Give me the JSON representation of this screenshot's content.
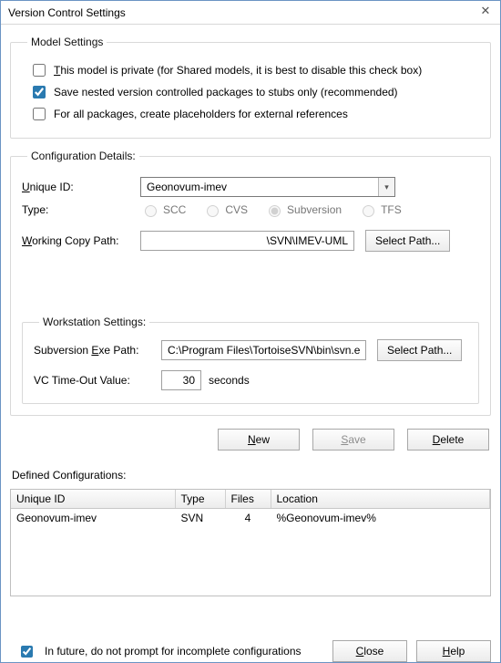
{
  "title": "Version Control Settings",
  "model_settings": {
    "legend": "Model Settings",
    "private_label": "This model is private (for Shared models, it is best to disable this check box)",
    "private_checked": false,
    "stubs_label": "Save nested version controlled packages to stubs only (recommended)",
    "stubs_checked": true,
    "placeholders_label": "For all packages, create placeholders for external references",
    "placeholders_checked": false
  },
  "config": {
    "legend": "Configuration Details:",
    "unique_id_label": "Unique ID:",
    "unique_id_value": "Geonovum-imev",
    "type_label": "Type:",
    "types": {
      "scc": "SCC",
      "cvs": "CVS",
      "svn": "Subversion",
      "tfs": "TFS",
      "selected": "svn"
    },
    "working_path_label": "Working Copy Path:",
    "working_path_value": "\\SVN\\IMEV-UML",
    "select_path_label": "Select Path..."
  },
  "workstation": {
    "legend": "Workstation Settings:",
    "exe_label": "Subversion Exe Path:",
    "exe_value": "C:\\Program Files\\TortoiseSVN\\bin\\svn.exe",
    "select_path_label": "Select Path...",
    "timeout_label": "VC Time-Out Value:",
    "timeout_value": "30",
    "timeout_unit": "seconds"
  },
  "buttons": {
    "new": "New",
    "save": "Save",
    "delete": "Delete",
    "close": "Close",
    "help": "Help"
  },
  "defined": {
    "label": "Defined Configurations:",
    "headers": {
      "id": "Unique ID",
      "type": "Type",
      "files": "Files",
      "location": "Location"
    },
    "rows": [
      {
        "id": "Geonovum-imev",
        "type": "SVN",
        "files": "4",
        "location": "%Geonovum-imev%"
      }
    ]
  },
  "footer": {
    "prompt_label": "In future, do not prompt for incomplete configurations",
    "prompt_checked": true
  }
}
